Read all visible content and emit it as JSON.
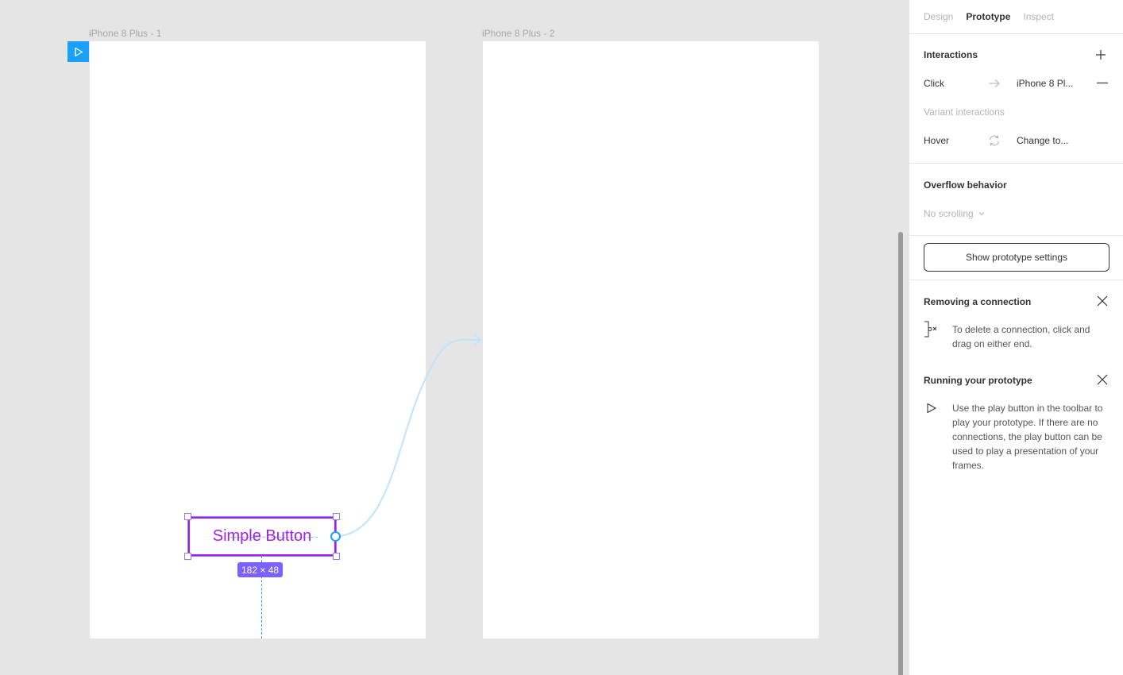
{
  "canvas": {
    "frames": [
      {
        "label": "iPhone 8 Plus - 1"
      },
      {
        "label": "iPhone 8 Plus - 2"
      }
    ],
    "selected_element": {
      "text": "Simple Button",
      "size_label": "182 × 48"
    },
    "colors": {
      "background": "#e5e5e5",
      "frame": "#ffffff",
      "accent_blue": "#18a0fb",
      "selection_purple": "#7b61ff",
      "button_text": "#a020f0",
      "connection_line": "#bfe3fd"
    }
  },
  "panel": {
    "tabs": [
      {
        "label": "Design",
        "active": false
      },
      {
        "label": "Prototype",
        "active": true
      },
      {
        "label": "Inspect",
        "active": false
      }
    ],
    "interactions": {
      "title": "Interactions",
      "add_icon": "plus-icon",
      "items": [
        {
          "trigger": "Click",
          "icon": "arrow-right-icon",
          "target": "iPhone 8 Pl...",
          "remove_icon": "minus-icon"
        }
      ],
      "variant_title": "Variant interactions",
      "variant_items": [
        {
          "trigger": "Hover",
          "icon": "swap-icon",
          "target": "Change to..."
        }
      ]
    },
    "overflow": {
      "title": "Overflow behavior",
      "value": "No scrolling"
    },
    "settings_button": "Show prototype settings",
    "help": [
      {
        "title": "Removing a connection",
        "icon": "connection-remove-icon",
        "text": "To delete a connection, click and drag on either end."
      },
      {
        "title": "Running your prototype",
        "icon": "play-icon",
        "text": "Use the play button in the toolbar to play your prototype. If there are no connections, the play button can be used to play a presentation of your frames."
      }
    ]
  }
}
